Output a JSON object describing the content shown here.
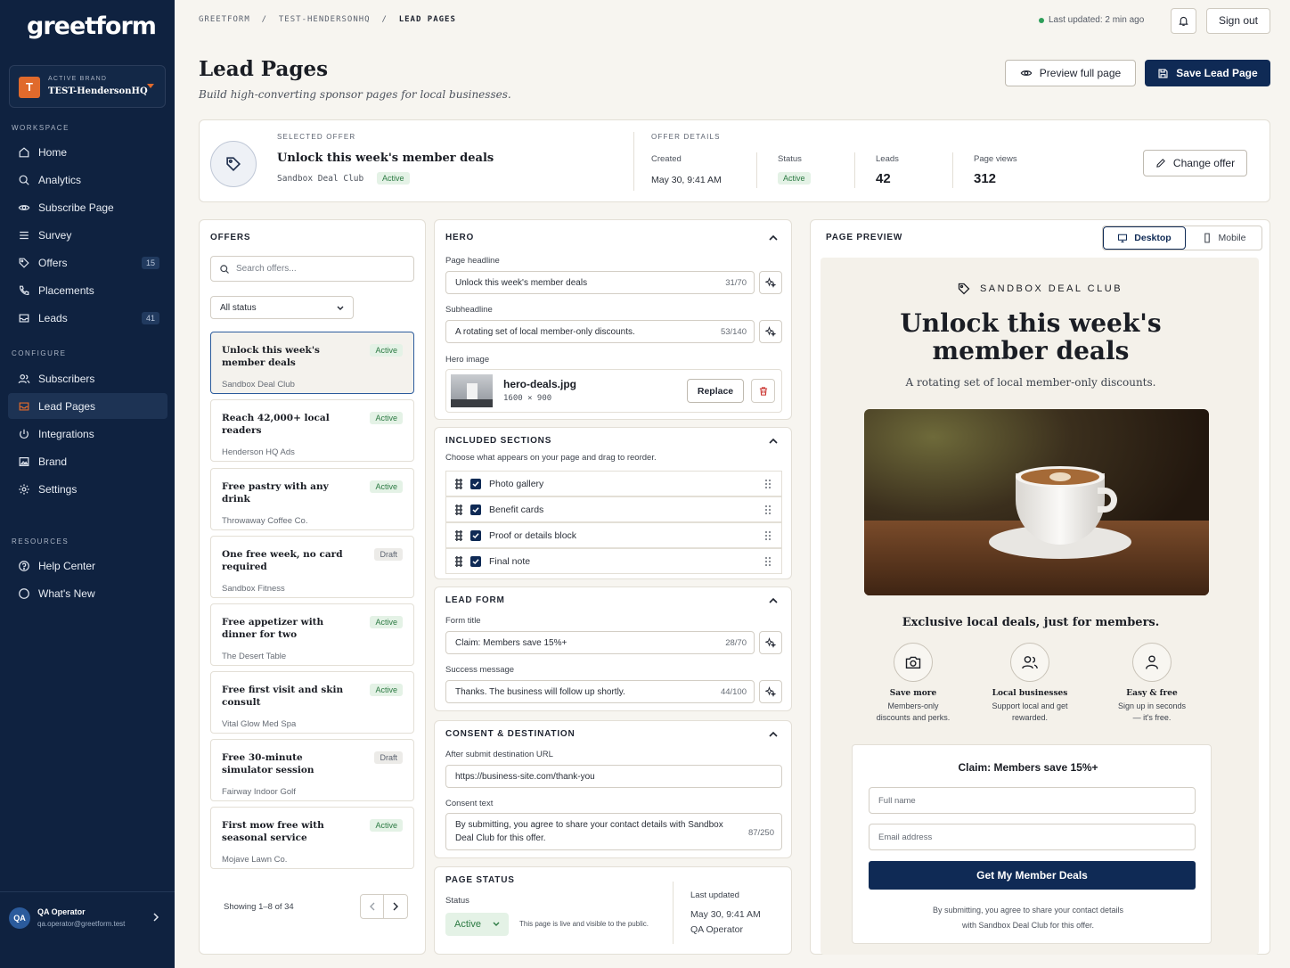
{
  "app": {
    "logo": "greetform"
  },
  "brand": {
    "label": "ACTIVE BRAND",
    "name": "TEST-HendersonHQ",
    "initial": "T"
  },
  "sidebar": {
    "workspace_label": "WORKSPACE",
    "workspace": [
      {
        "label": "Home"
      },
      {
        "label": "Analytics"
      },
      {
        "label": "Subscribe Page"
      },
      {
        "label": "Survey"
      },
      {
        "label": "Offers",
        "count": "15"
      },
      {
        "label": "Placements"
      },
      {
        "label": "Leads",
        "count": "41"
      }
    ],
    "configure_label": "CONFIGURE",
    "configure": [
      {
        "label": "Subscribers"
      },
      {
        "label": "Lead Pages"
      },
      {
        "label": "Integrations"
      },
      {
        "label": "Brand"
      },
      {
        "label": "Settings"
      }
    ],
    "resources_label": "RESOURCES",
    "resources": [
      {
        "label": "Help Center"
      },
      {
        "label": "What's New"
      }
    ]
  },
  "user": {
    "initials": "QA",
    "name": "QA Operator",
    "email": "qa.operator@greetform.test"
  },
  "header": {
    "crumbs": [
      "GREETFORM",
      "TEST-HENDERSONHQ",
      "LEAD PAGES"
    ],
    "sep": "/",
    "last_updated": "Last updated: 2 min ago",
    "sign_out": "Sign out"
  },
  "page": {
    "title": "Lead Pages",
    "subtitle": "Build high-converting sponsor pages for local businesses.",
    "preview_btn": "Preview full page",
    "save_btn": "Save Lead Page"
  },
  "selected_offer": {
    "caption": "SELECTED OFFER",
    "title": "Unlock this week's member deals",
    "brand": "Sandbox Deal Club",
    "status": "Active",
    "details_caption": "OFFER DETAILS",
    "created_label": "Created",
    "created": "May 30, 9:41 AM",
    "status_label": "Status",
    "leads_label": "Leads",
    "leads": "42",
    "views_label": "Page views",
    "views": "312",
    "change_btn": "Change offer"
  },
  "offers": {
    "heading": "OFFERS",
    "search_placeholder": "Search offers...",
    "filter": "All status",
    "items": [
      {
        "title": "Unlock this week's member deals",
        "brand": "Sandbox Deal Club",
        "status": "Active"
      },
      {
        "title": "Reach 42,000+ local readers",
        "brand": "Henderson HQ Ads",
        "status": "Active"
      },
      {
        "title": "Free pastry with any drink",
        "brand": "Throwaway Coffee Co.",
        "status": "Active"
      },
      {
        "title": "One free week, no card required",
        "brand": "Sandbox Fitness",
        "status": "Draft"
      },
      {
        "title": "Free appetizer with dinner for two",
        "brand": "The Desert Table",
        "status": "Active"
      },
      {
        "title": "Free first visit and skin consult",
        "brand": "Vital Glow Med Spa",
        "status": "Active"
      },
      {
        "title": "Free 30-minute simulator session",
        "brand": "Fairway Indoor Golf",
        "status": "Draft"
      },
      {
        "title": "First mow free with seasonal service",
        "brand": "Mojave Lawn Co.",
        "status": "Active"
      }
    ],
    "showing": "Showing 1–8 of 34"
  },
  "hero": {
    "heading": "HERO",
    "headline_label": "Page headline",
    "headline": "Unlock this week's member deals",
    "headline_count": "31/70",
    "sub_label": "Subheadline",
    "sub": "A rotating set of local member-only discounts.",
    "sub_count": "53/140",
    "image_label": "Hero image",
    "image_name": "hero-deals.jpg",
    "image_dims": "1600 × 900",
    "replace": "Replace"
  },
  "sections": {
    "heading": "INCLUDED SECTIONS",
    "help": "Choose what appears on your page and drag to reorder.",
    "items": [
      {
        "label": "Photo gallery"
      },
      {
        "label": "Benefit cards"
      },
      {
        "label": "Proof or details block"
      },
      {
        "label": "Final note"
      }
    ]
  },
  "lead_form": {
    "heading": "LEAD FORM",
    "title_label": "Form title",
    "title": "Claim: Members save 15%+",
    "title_count": "28/70",
    "success_label": "Success message",
    "success": "Thanks. The business will follow up shortly.",
    "success_count": "44/100"
  },
  "consent": {
    "heading": "CONSENT & DESTINATION",
    "url_label": "After submit destination URL",
    "url": "https://business-site.com/thank-you",
    "text_label": "Consent text",
    "text": "By submitting, you agree to share your contact details with Sandbox Deal Club for this offer.",
    "text_count": "87/250"
  },
  "page_status": {
    "heading": "PAGE STATUS",
    "status_label": "Status",
    "status": "Active",
    "note": "This page is live and visible to the public.",
    "updated_label": "Last updated",
    "updated": "May 30, 9:41 AM",
    "updated_by": "QA Operator"
  },
  "preview": {
    "heading": "PAGE PREVIEW",
    "desktop": "Desktop",
    "mobile": "Mobile",
    "brand": "SANDBOX DEAL CLUB",
    "headline_1": "Unlock this week's",
    "headline_2": "member deals",
    "sub": "A rotating set of local member-only discounts.",
    "section_title": "Exclusive local deals, just for members.",
    "features": [
      {
        "title": "Save more",
        "d1": "Members-only",
        "d2": "discounts and perks."
      },
      {
        "title": "Local businesses",
        "d1": "Support local and get",
        "d2": "rewarded."
      },
      {
        "title": "Easy & free",
        "d1": "Sign up in seconds",
        "d2": "— it's free."
      }
    ],
    "form_title": "Claim: Members save 15%+",
    "name_placeholder": "Full name",
    "email_placeholder": "Email address",
    "cta": "Get My Member Deals",
    "consent_1": "By submitting, you agree to share your contact details",
    "consent_2": "with Sandbox Deal Club for this offer."
  },
  "colors": {
    "navy": "#0f2240",
    "primary": "#0f2a55",
    "accent": "#e06a2c",
    "active_green": "#2c7a43"
  }
}
